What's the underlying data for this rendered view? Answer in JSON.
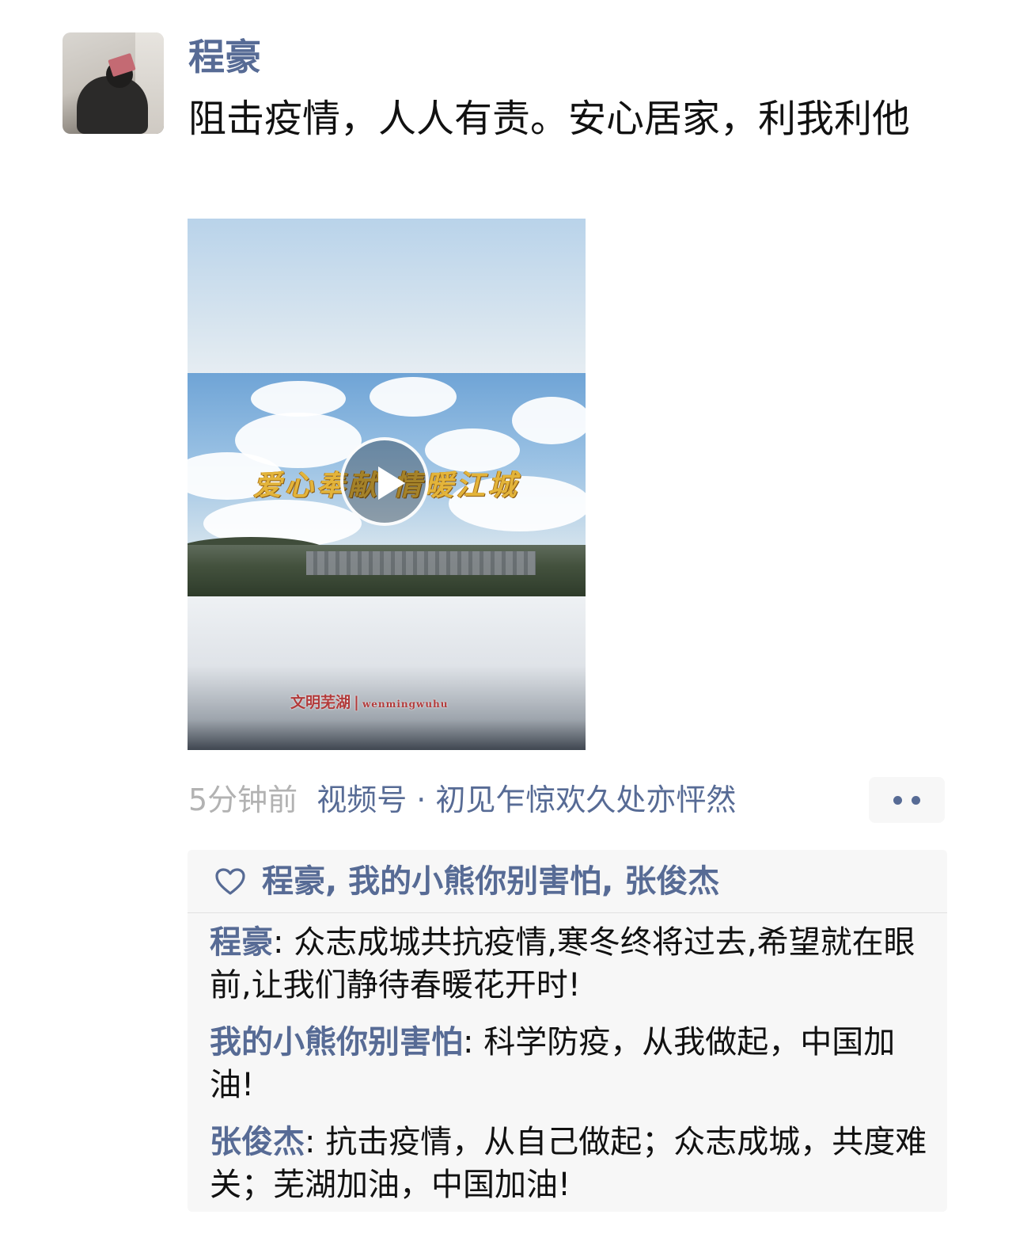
{
  "post": {
    "author": "程豪",
    "text": "阻击疫情，人人有责。安心居家，利我利他",
    "time": "5分钟前",
    "channel": "视频号 · 初见乍惊欢久处亦怦然"
  },
  "video": {
    "title": "爱心奉献 情暖江城",
    "watermark_cn": "文明芜湖",
    "watermark_sep": "|",
    "watermark_en": "wenmingwuhu"
  },
  "likes": {
    "names": "程豪, 我的小熊你别害怕, 张俊杰"
  },
  "comments": [
    {
      "author": "程豪",
      "text": ": 众志成城共抗疫情,寒冬终将过去,希望就在眼前,让我们静待春暖花开时!"
    },
    {
      "author": "我的小熊你别害怕",
      "text": ": 科学防疫，从我做起，中国加油!"
    },
    {
      "author": "张俊杰",
      "text": ": 抗击疫情，从自己做起；众志成城，共度难关；芜湖加油，中国加油!"
    }
  ],
  "icons": {
    "like": "heart-icon",
    "play": "play-icon",
    "more": "more-dots-icon"
  },
  "colors": {
    "link": "#576b95",
    "time": "#b2b2b2",
    "panel": "#f7f7f7"
  }
}
